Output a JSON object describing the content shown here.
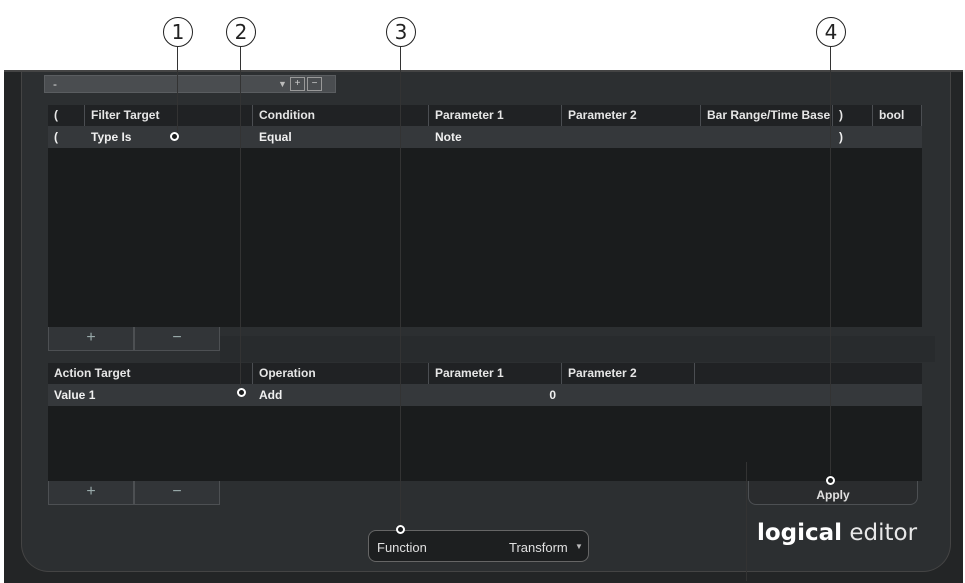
{
  "callouts": [
    "1",
    "2",
    "3",
    "4"
  ],
  "preset": {
    "value": "-",
    "store_icon": "store-preset-icon",
    "remove_icon": "remove-preset-icon"
  },
  "filter": {
    "columns": [
      "(",
      "Filter Target",
      "Condition",
      "Parameter 1",
      "Parameter 2",
      "Bar Range/Time Base",
      ")",
      "bool"
    ],
    "rows": [
      {
        "open": "(",
        "target": "Type Is",
        "condition": "Equal",
        "param1": "Note",
        "param2": "",
        "range": "",
        "close": ")",
        "bool": ""
      }
    ],
    "add_label": "+",
    "remove_label": "−"
  },
  "action": {
    "columns": [
      "Action Target",
      "Operation",
      "Parameter 1",
      "Parameter 2"
    ],
    "rows": [
      {
        "target": "Value 1",
        "operation": "Add",
        "param1": "0",
        "param2": ""
      }
    ],
    "add_label": "+",
    "remove_label": "−"
  },
  "apply_label": "Apply",
  "function": {
    "label": "Function",
    "value": "Transform"
  },
  "logo": {
    "bold": "logical",
    "light": "editor"
  },
  "colors": {
    "background": "#2c2f31",
    "table": "#1a1c1d",
    "row": "#35383b",
    "text": "#f0f0f0"
  }
}
